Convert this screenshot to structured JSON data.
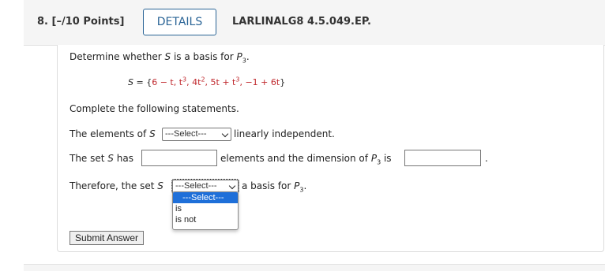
{
  "question": {
    "number": "8.",
    "points": "[–/10 Points]",
    "details_label": "DETAILS",
    "code": "LARLINALG8 4.5.049.EP."
  },
  "prompt": {
    "p1": "Determine whether ",
    "var_s": "S",
    "p2": " is a basis for ",
    "var_p": "P",
    "sub3": "3",
    "period": "."
  },
  "set_def": {
    "lhs": "S",
    "eq": " = {",
    "e1": "6 − t, t",
    "sup3a": "3",
    "e2": ", 4t",
    "sup2": "2",
    "e3": ", 5t + t",
    "sup3b": "3",
    "e4": ", −1 + 6t",
    "close": "}"
  },
  "instructions": "Complete the following statements.",
  "stmt1": {
    "pre": "The elements of ",
    "var": "S",
    "select_value": "---Select---",
    "post": "linearly independent."
  },
  "stmt2": {
    "pre": "The set ",
    "var": "S",
    "mid1": " has",
    "mid2": "elements and the dimension of ",
    "var_p": "P",
    "sub3": "3",
    "mid3": " is",
    "end": "."
  },
  "stmt3": {
    "pre": "Therefore, the set ",
    "var": "S",
    "select_value": "---Select---",
    "post": "a basis for ",
    "var_p": "P",
    "sub3": "3",
    "end": "."
  },
  "dropdown_options": [
    "---Select---",
    "is",
    "is not"
  ],
  "submit_label": "Submit Answer",
  "colors": {
    "accent": "#2a6496",
    "math_red": "#c0282d",
    "selected_option": "#1e6fd9"
  }
}
